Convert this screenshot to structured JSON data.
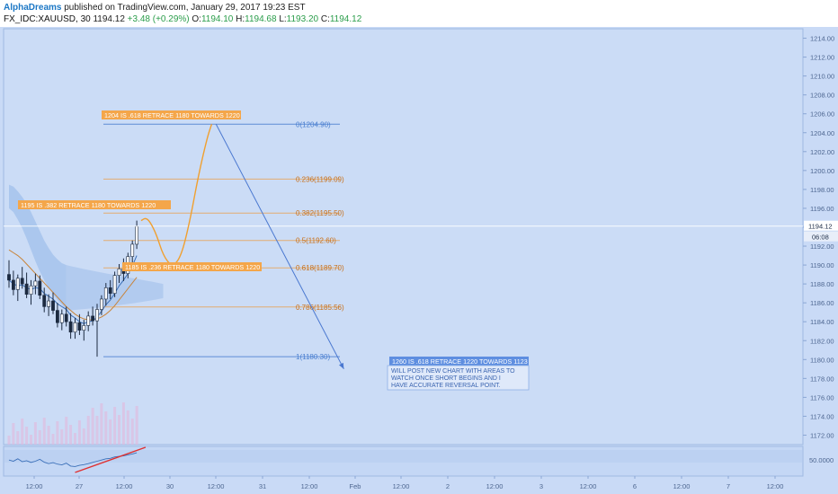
{
  "header": {
    "author": "AlphaDreams",
    "published": "published on TradingView.com, January 29, 2017 19:23 EST",
    "symbol": "FX_IDC:XAUUSD, 30",
    "last": "1194.12",
    "change": "+3.48 (+0.29%)",
    "o_label": "O:",
    "o_value": "1194.10",
    "h_label": "H:",
    "h_value": "1194.68",
    "l_label": "L:",
    "l_value": "1193.20",
    "c_label": "C:",
    "c_value": "1194.12"
  },
  "colors": {
    "background": "#c9daf6",
    "plot_area": "#cbdcf6",
    "fib_line": "#e8a45a",
    "fib_label": "#c8701a",
    "fib_zero": "#4a7fd0",
    "projection": "#f0a030",
    "arrow": "#4a78d0",
    "cloud": "#a6c3ec",
    "ma_orange": "#c8843a",
    "ma_blue": "#3a6fb8",
    "rsi_trend": "#e03030",
    "price_line": "#ffffff"
  },
  "chart_data": {
    "type": "candlestick",
    "title": "",
    "y_axis": {
      "min": 1171,
      "max": 1215,
      "ticks": [
        1172,
        1174,
        1176,
        1178,
        1180,
        1182,
        1184,
        1186,
        1188,
        1190,
        1192,
        1194,
        1196,
        1198,
        1200,
        1202,
        1204,
        1206,
        1208,
        1210,
        1212,
        1214
      ],
      "tick_labels": [
        "1172.00",
        "1174.00",
        "1176.00",
        "1178.00",
        "1180.00",
        "1182.00",
        "1184.00",
        "1186.00",
        "1188.00",
        "1190.00",
        "1192.00",
        "1194.00",
        "1196.00",
        "1198.00",
        "1200.00",
        "1202.00",
        "1204.00",
        "1206.00",
        "1208.00",
        "1210.00",
        "1212.00",
        "1214.00"
      ]
    },
    "x_axis": {
      "tick_labels": [
        "12:00",
        "27",
        "12:00",
        "30",
        "12:00",
        "31",
        "12:00",
        "Feb",
        "12:00",
        "2",
        "12:00",
        "3",
        "12:00",
        "6",
        "12:00",
        "7",
        "12:00"
      ]
    },
    "price_marker": {
      "value": 1194.12,
      "label": "1194.12",
      "countdown": "06:08"
    },
    "rsi_label": "50.0000",
    "candles": [
      {
        "o": 1189.0,
        "h": 1190.5,
        "l": 1187.6,
        "c": 1188.4
      },
      {
        "o": 1188.4,
        "h": 1189.4,
        "l": 1186.8,
        "c": 1187.4
      },
      {
        "o": 1187.4,
        "h": 1189.0,
        "l": 1186.2,
        "c": 1188.6
      },
      {
        "o": 1188.6,
        "h": 1189.8,
        "l": 1187.5,
        "c": 1188.0
      },
      {
        "o": 1188.0,
        "h": 1189.2,
        "l": 1186.5,
        "c": 1186.9
      },
      {
        "o": 1186.9,
        "h": 1188.4,
        "l": 1185.8,
        "c": 1187.8
      },
      {
        "o": 1187.8,
        "h": 1189.1,
        "l": 1186.9,
        "c": 1188.3
      },
      {
        "o": 1188.3,
        "h": 1188.9,
        "l": 1186.4,
        "c": 1186.8
      },
      {
        "o": 1186.8,
        "h": 1187.6,
        "l": 1185.0,
        "c": 1185.6
      },
      {
        "o": 1185.6,
        "h": 1186.9,
        "l": 1184.6,
        "c": 1186.2
      },
      {
        "o": 1186.2,
        "h": 1187.1,
        "l": 1184.8,
        "c": 1185.2
      },
      {
        "o": 1185.2,
        "h": 1186.0,
        "l": 1183.4,
        "c": 1183.9
      },
      {
        "o": 1183.9,
        "h": 1185.3,
        "l": 1183.1,
        "c": 1184.8
      },
      {
        "o": 1184.8,
        "h": 1185.6,
        "l": 1183.5,
        "c": 1184.0
      },
      {
        "o": 1184.0,
        "h": 1184.9,
        "l": 1182.2,
        "c": 1182.9
      },
      {
        "o": 1182.9,
        "h": 1184.4,
        "l": 1182.2,
        "c": 1183.9
      },
      {
        "o": 1183.9,
        "h": 1184.8,
        "l": 1182.6,
        "c": 1183.1
      },
      {
        "o": 1183.1,
        "h": 1184.2,
        "l": 1182.0,
        "c": 1183.6
      },
      {
        "o": 1183.6,
        "h": 1185.1,
        "l": 1183.0,
        "c": 1184.6
      },
      {
        "o": 1184.6,
        "h": 1185.6,
        "l": 1183.6,
        "c": 1184.1
      },
      {
        "o": 1184.1,
        "h": 1185.9,
        "l": 1180.3,
        "c": 1185.3
      },
      {
        "o": 1185.3,
        "h": 1186.8,
        "l": 1184.7,
        "c": 1186.4
      },
      {
        "o": 1186.4,
        "h": 1188.1,
        "l": 1185.7,
        "c": 1187.6
      },
      {
        "o": 1187.6,
        "h": 1188.4,
        "l": 1186.4,
        "c": 1187.0
      },
      {
        "o": 1187.0,
        "h": 1189.3,
        "l": 1186.6,
        "c": 1188.9
      },
      {
        "o": 1188.9,
        "h": 1190.1,
        "l": 1188.1,
        "c": 1189.6
      },
      {
        "o": 1189.6,
        "h": 1190.7,
        "l": 1188.3,
        "c": 1189.1
      },
      {
        "o": 1189.1,
        "h": 1191.3,
        "l": 1188.6,
        "c": 1190.9
      },
      {
        "o": 1190.9,
        "h": 1192.6,
        "l": 1190.1,
        "c": 1192.2
      },
      {
        "o": 1192.2,
        "h": 1194.7,
        "l": 1191.7,
        "c": 1194.1
      }
    ],
    "ma_orange": [
      1191.6,
      1191.3,
      1191.0,
      1190.6,
      1190.1,
      1189.6,
      1189.1,
      1188.6,
      1188.1,
      1187.6,
      1187.1,
      1186.6,
      1186.1,
      1185.6,
      1185.2,
      1184.8,
      1184.5,
      1184.3,
      1184.2,
      1184.2,
      1184.3,
      1184.5,
      1184.8,
      1185.2,
      1185.7,
      1186.3,
      1186.9,
      1187.5,
      1188.1,
      1188.7
    ],
    "ma_blue": [
      1188.4,
      1188.0,
      1187.8,
      1187.9,
      1187.6,
      1187.4,
      1187.6,
      1187.5,
      1187.0,
      1186.7,
      1186.4,
      1185.9,
      1185.6,
      1185.3,
      1184.7,
      1184.4,
      1184.0,
      1183.8,
      1184.0,
      1184.1,
      1184.5,
      1185.1,
      1185.8,
      1186.3,
      1187.0,
      1187.8,
      1188.4,
      1189.1,
      1189.9,
      1191.0
    ],
    "cloud_upper": [
      1198.5,
      1198.3,
      1197.8,
      1197.2,
      1196.5,
      1195.6,
      1194.6,
      1193.6,
      1192.6,
      1191.8,
      1191.1,
      1190.6,
      1190.2,
      1190.0
    ],
    "cloud_lower": [
      1196.0,
      1195.6,
      1194.8,
      1193.9,
      1192.8,
      1191.6,
      1190.4,
      1189.3,
      1188.4,
      1187.6,
      1186.9,
      1186.3,
      1185.8,
      1185.2
    ],
    "fibonacci": [
      {
        "ratio": 0,
        "value": 1204.9,
        "label": "0(1204.90)"
      },
      {
        "ratio": 0.236,
        "value": 1199.09,
        "label": "0.236(1199.09)"
      },
      {
        "ratio": 0.382,
        "value": 1195.5,
        "label": "0.382(1195.50)"
      },
      {
        "ratio": 0.5,
        "value": 1192.6,
        "label": "0.5(1192.60)"
      },
      {
        "ratio": 0.618,
        "value": 1189.7,
        "label": "0.618(1189.70)"
      },
      {
        "ratio": 0.786,
        "value": 1185.56,
        "label": "0.786(1185.56)"
      },
      {
        "ratio": 1,
        "value": 1180.3,
        "label": "1(1180.30)"
      }
    ],
    "projection_curve": [
      {
        "i": 30.0,
        "v": 1194.7
      },
      {
        "i": 31.0,
        "v": 1195.0
      },
      {
        "i": 32.0,
        "v": 1194.6
      },
      {
        "i": 33.5,
        "v": 1193.2
      },
      {
        "i": 35.0,
        "v": 1191.0
      },
      {
        "i": 37.0,
        "v": 1189.8
      },
      {
        "i": 39.0,
        "v": 1190.8
      },
      {
        "i": 41.0,
        "v": 1194.5
      },
      {
        "i": 43.0,
        "v": 1199.5
      },
      {
        "i": 45.0,
        "v": 1203.5
      },
      {
        "i": 46.0,
        "v": 1204.9
      }
    ],
    "arrow": {
      "from": {
        "i": 47.0,
        "v": 1204.9
      },
      "to": {
        "i": 76.0,
        "v": 1179.0
      }
    },
    "annotations": [
      {
        "text": "1204 IS .618 RETRACE 1180 TOWARDS 1220",
        "style": "orange"
      },
      {
        "text": "1195 IS .382 RETRACE 1180 TOWARDS 1220",
        "style": "orange"
      },
      {
        "text": "1185 IS .236 RETRACE 1180 TOWARDS 1220",
        "style": "orange"
      },
      {
        "text": "1260 IS .618 RETRACE 1220 TOWARDS 1123",
        "style": "blue"
      },
      {
        "text": "WILL POST NEW CHART WITH AREAS TO WATCH ONCE SHORT BEGINS AND I HAVE ACCURATE REVERSAL POINT.",
        "style": "note"
      }
    ]
  }
}
